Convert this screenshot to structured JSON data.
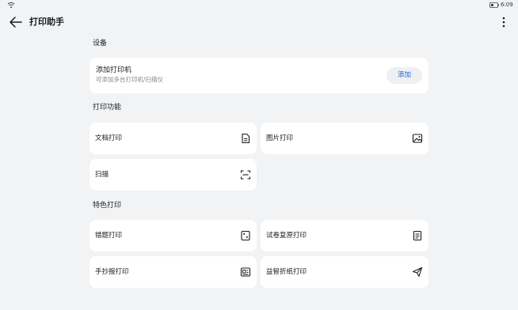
{
  "status_bar": {
    "time": "6:09"
  },
  "app_bar": {
    "title": "打印助手"
  },
  "sections": {
    "devices": "设备",
    "print_functions": "打印功能",
    "special_print": "特色打印"
  },
  "add_printer": {
    "title": "添加打印机",
    "subtitle": "可添加多台打印机/扫描仪",
    "button": "添加"
  },
  "print_functions": {
    "document": "文档打印",
    "picture": "图片打印",
    "scan": "扫描"
  },
  "special_print": {
    "wrong_questions": "错题打印",
    "exam_restore": "试卷复原打印",
    "handwritten_newspaper": "手抄报打印",
    "origami": "益智折纸打印"
  },
  "colors": {
    "accent": "#1a66d9",
    "background": "#f1f3f5",
    "card": "#ffffff"
  }
}
